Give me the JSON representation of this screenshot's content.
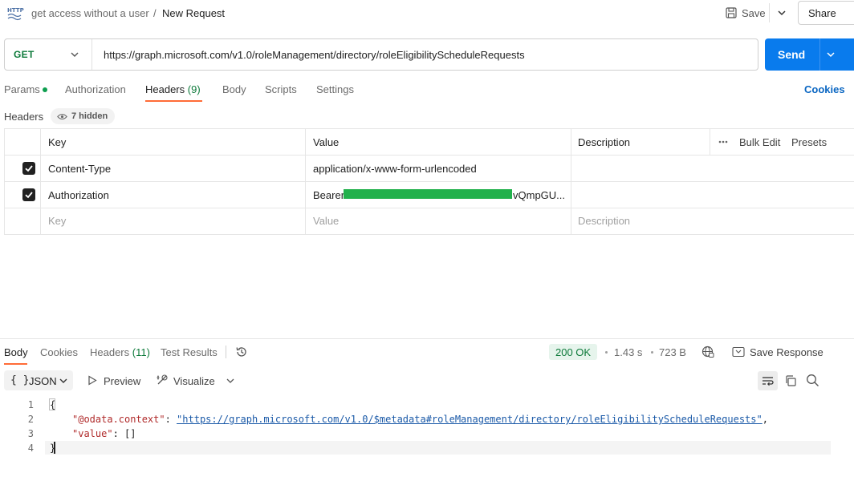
{
  "header": {
    "breadcrumb_parent": "get access without a user",
    "breadcrumb_sep": "/",
    "title": "New Request",
    "save_label": "Save",
    "share_label": "Share"
  },
  "request": {
    "method": "GET",
    "url": "https://graph.microsoft.com/v1.0/roleManagement/directory/roleEligibilityScheduleRequests",
    "send_label": "Send"
  },
  "tabs": {
    "params": "Params",
    "authorization": "Authorization",
    "headers": "Headers",
    "headers_count": "(9)",
    "body": "Body",
    "scripts": "Scripts",
    "settings": "Settings",
    "cookies": "Cookies"
  },
  "headers_section": {
    "label": "Headers",
    "hidden": "7 hidden",
    "columns": {
      "key": "Key",
      "value": "Value",
      "description": "Description"
    },
    "bulk_edit": "Bulk Edit",
    "presets": "Presets",
    "rows": [
      {
        "key": "Content-Type",
        "value": "application/x-www-form-urlencoded",
        "checked": true
      },
      {
        "key": "Authorization",
        "value_prefix": "Bearer",
        "value_suffix": "vQmpGU...",
        "checked": true
      }
    ],
    "placeholders": {
      "key": "Key",
      "value": "Value",
      "description": "Description"
    }
  },
  "response": {
    "tabs": {
      "body": "Body",
      "cookies": "Cookies",
      "headers": "Headers",
      "headers_count": "(11)",
      "test_results": "Test Results"
    },
    "status": "200 OK",
    "time": "1.43 s",
    "size": "723 B",
    "save_response": "Save Response",
    "format": "JSON",
    "format_braces": "{ }",
    "preview": "Preview",
    "visualize": "Visualize",
    "code": {
      "line_numbers": [
        "1",
        "2",
        "3",
        "4"
      ],
      "open_brace": "{",
      "context_key": "\"@odata.context\"",
      "colon": ": ",
      "context_value": "\"https://graph.microsoft.com/v1.0/$metadata#roleManagement/directory/roleEligibilityScheduleRequests\"",
      "comma": ",",
      "value_key": "\"value\"",
      "value_val": "[]",
      "close_brace": "}"
    }
  },
  "colors": {
    "accent": "#ff6c37",
    "send": "#097bed",
    "method_get": "#0d7a3a",
    "redaction": "#22b14c"
  }
}
